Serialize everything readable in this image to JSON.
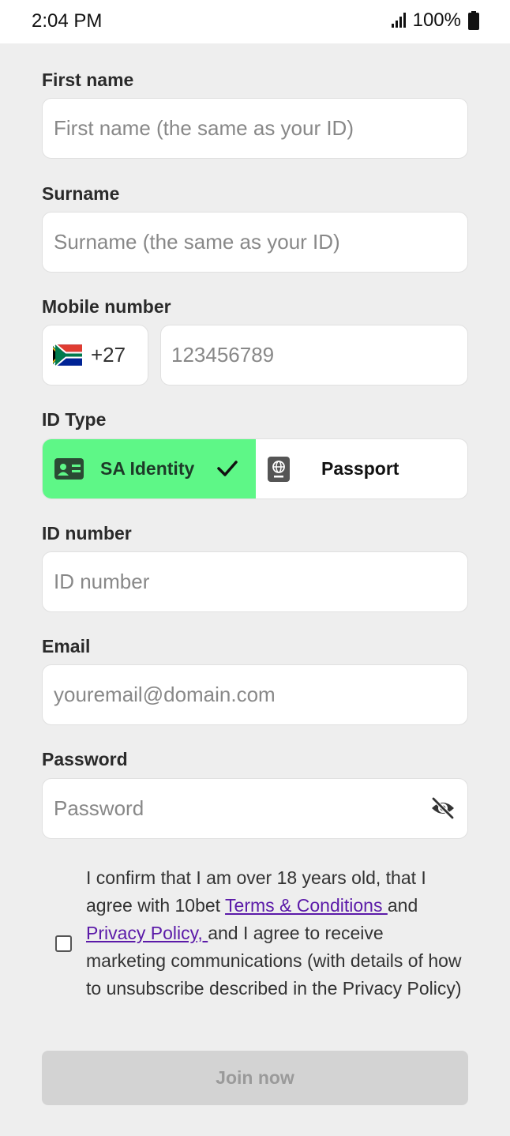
{
  "status": {
    "time": "2:04 PM",
    "battery": "100%"
  },
  "form": {
    "first_name": {
      "label": "First name",
      "placeholder": "First name (the same as your ID)"
    },
    "surname": {
      "label": "Surname",
      "placeholder": "Surname (the same as your ID)"
    },
    "mobile": {
      "label": "Mobile number",
      "country_code": "+27",
      "placeholder": "123456789"
    },
    "id_type": {
      "label": "ID Type",
      "options": [
        "SA Identity",
        "Passport"
      ],
      "selected": "SA Identity"
    },
    "id_number": {
      "label": "ID number",
      "placeholder": "ID number"
    },
    "email": {
      "label": "Email",
      "placeholder": "youremail@domain.com"
    },
    "password": {
      "label": "Password",
      "placeholder": "Password"
    }
  },
  "consent": {
    "checked": false,
    "text_1": "I confirm that I am over 18 years old, that I agree with 10bet ",
    "link_terms": "Terms & Conditions ",
    "text_2": "and ",
    "link_privacy": "Privacy Policy, ",
    "text_3": "and I agree to receive marketing communications (with details of how to unsubscribe described in the Privacy Policy)"
  },
  "join_button": "Join now",
  "colors": {
    "accent_green": "#5ef787",
    "link_purple": "#5b1aa8",
    "disabled_button": "#d3d3d3"
  }
}
